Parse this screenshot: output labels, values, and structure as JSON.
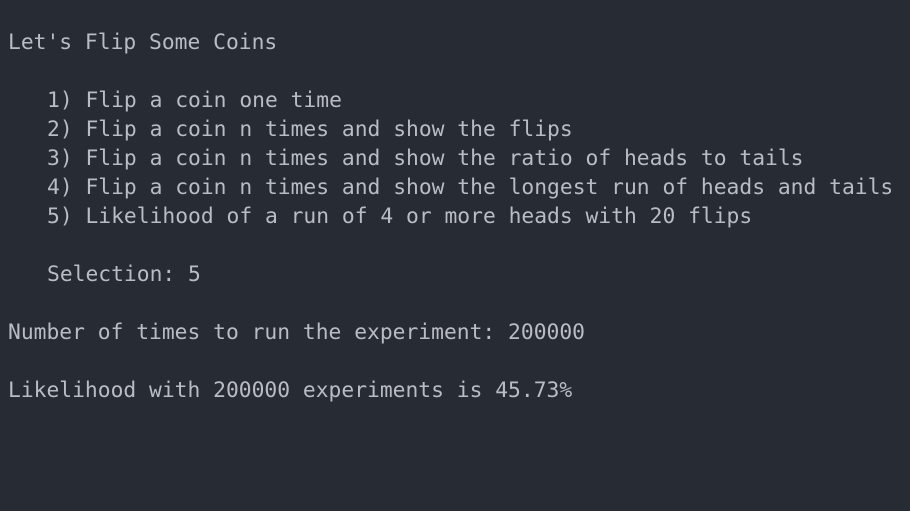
{
  "terminal": {
    "title_line": "Let's Flip Some Coins",
    "menu": [
      "1) Flip a coin one time",
      "2) Flip a coin n times and show the flips",
      "3) Flip a coin n times and show the ratio of heads to tails",
      "4) Flip a coin n times and show the longest run of heads and tails",
      "5) Likelihood of a run of 4 or more heads with 20 flips"
    ],
    "selection_line": "Selection: 5",
    "prompt_line": "Number of times to run the experiment: 200000",
    "result_line": "Likelihood with 200000 experiments is 45.73%"
  }
}
